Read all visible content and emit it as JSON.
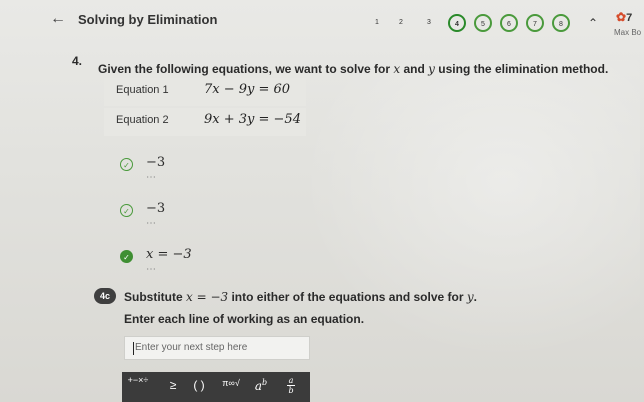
{
  "header": {
    "back_icon": "arrow-left-icon",
    "title": "Solving by Elimination",
    "steps": [
      "1",
      "2",
      "3",
      "4",
      "5",
      "6",
      "7",
      "8"
    ],
    "current_step": "4",
    "streak_value": "7",
    "max_label": "Max Bo"
  },
  "question": {
    "number": "4.",
    "text_prefix": "Given the following equations, we want to solve for ",
    "var_x": "x",
    "text_mid": " and ",
    "var_y": "y",
    "text_suffix": " using the elimination method.",
    "equations": [
      {
        "label": "Equation 1",
        "expr": "7x − 9y = 60"
      },
      {
        "label": "Equation 2",
        "expr": "9x + 3y = −54"
      }
    ]
  },
  "answers": [
    {
      "value": "−3"
    },
    {
      "value": "−3"
    },
    {
      "value": "x = −3"
    }
  ],
  "part": {
    "badge": "4c",
    "instruction_prefix": "Substitute ",
    "instruction_math": "x = −3",
    "instruction_suffix": " into either of the equations and solve for ",
    "instruction_var": "y",
    "instruction_end": ".",
    "enter_text": "Enter each line of working as an equation.",
    "input_placeholder": "Enter your next step here"
  },
  "toolbar": {
    "ops": "+−×÷",
    "ineq": "≥",
    "parens": "( )",
    "special": "π∞√",
    "power_base": "a",
    "power_exp": "b",
    "frac_num": "a",
    "frac_den": "b"
  },
  "colors": {
    "accent": "#3f8f33",
    "toolbar_bg": "#3b3b3b"
  }
}
